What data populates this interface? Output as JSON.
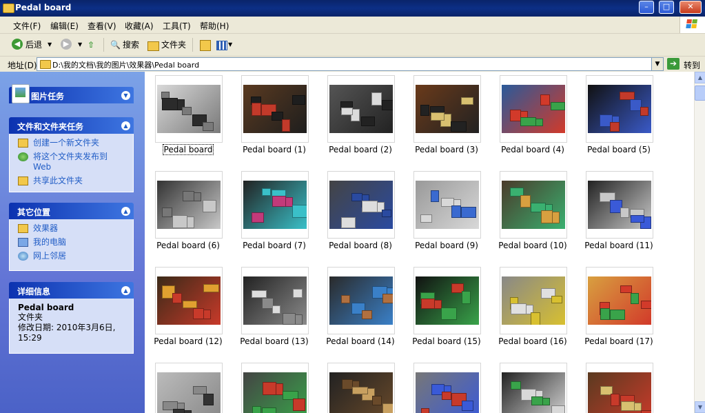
{
  "window": {
    "title": "Pedal board",
    "min": "–",
    "max": "□",
    "close": "✕"
  },
  "menu": [
    "文件(F)",
    "编辑(E)",
    "查看(V)",
    "收藏(A)",
    "工具(T)",
    "帮助(H)"
  ],
  "toolbar": {
    "back": "后退",
    "search": "搜索",
    "folders": "文件夹"
  },
  "address": {
    "label": "地址(D)",
    "path": "D:\\我的文档\\我的图片\\效果器\\Pedal board",
    "go": "转到"
  },
  "sidebar": {
    "picture_tasks": {
      "title": "图片任务"
    },
    "file_tasks": {
      "title": "文件和文件夹任务",
      "items": [
        "创建一个新文件夹",
        "将这个文件夹发布到 Web",
        "共享此文件夹"
      ]
    },
    "other_places": {
      "title": "其它位置",
      "items": [
        "效果器",
        "我的电脑",
        "网上邻居"
      ]
    },
    "details": {
      "title": "详细信息",
      "name": "Pedal board",
      "type": "文件夹",
      "modified": "修改日期: 2010年3月6日, 15:29"
    }
  },
  "files": [
    "Pedal board",
    "Pedal board (1)",
    "Pedal board (2)",
    "Pedal board (3)",
    "Pedal board (4)",
    "Pedal board (5)",
    "Pedal board (6)",
    "Pedal board (7)",
    "Pedal board (8)",
    "Pedal board (9)",
    "Pedal board (10)",
    "Pedal board (11)",
    "Pedal board (12)",
    "Pedal board (13)",
    "Pedal board (14)",
    "Pedal board (15)",
    "Pedal board (16)",
    "Pedal board (17)",
    "",
    "",
    "",
    "",
    "",
    ""
  ],
  "colors": {
    "titlebar": "#0a246a",
    "sidebar": "#6375d6",
    "link": "#215dc6"
  }
}
